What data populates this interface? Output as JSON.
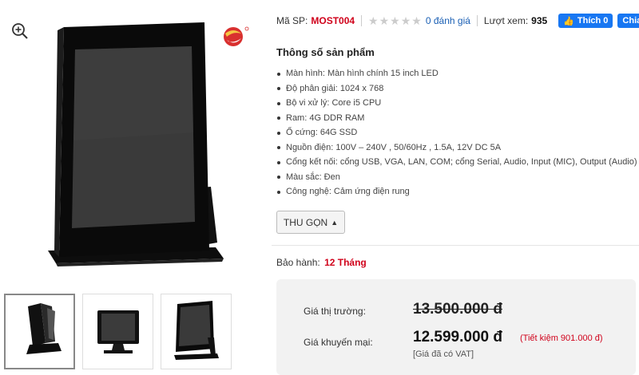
{
  "product": {
    "sku_label": "Mã SP:",
    "sku": "MOST004",
    "rating_stars": 0,
    "reviews": "0 đánh giá",
    "views_label": "Lượt xem:",
    "views": "935"
  },
  "social": {
    "like_label": "Thích 0",
    "share_label": "Chia sẻ"
  },
  "specs": {
    "title": "Thông số sản phẩm",
    "items": [
      "Màn hình: Màn hình chính 15 inch LED",
      "Độ phân giải: 1024 x 768",
      "Bộ vi xử lý: Core i5 CPU",
      "Ram: 4G DDR RAM",
      "Ổ cứng: 64G SSD",
      "Nguồn điện: 100V – 240V , 50/60Hz , 1.5A, 12V DC 5A",
      "Cổng kết nối: cổng USB, VGA, LAN, COM; cổng Serial, Audio, Input (MIC), Output (Audio)",
      "Màu sắc: Đen",
      "Công nghệ: Cảm ứng điện rung"
    ],
    "collapse_label": "THU GỌN"
  },
  "warranty": {
    "label": "Bảo hành:",
    "value": "12 Tháng"
  },
  "pricing": {
    "market_label": "Giá thị trường:",
    "market_price": "13.500.000 đ",
    "promo_label": "Giá khuyến mại:",
    "promo_price": "12.599.000 đ",
    "saving": "(Tiết kiệm 901.000 đ)",
    "vat_note": "[Giá đã có VAT]"
  },
  "gallery": {
    "icons": [
      "zoom-in-icon"
    ],
    "thumbnails": [
      "thumb-side-view",
      "thumb-front-view",
      "thumb-angle-view"
    ],
    "active_thumbnail": 0
  },
  "colors": {
    "accent_red": "#d0021b",
    "link_blue": "#1a5fb4",
    "facebook_blue": "#1877f2"
  }
}
